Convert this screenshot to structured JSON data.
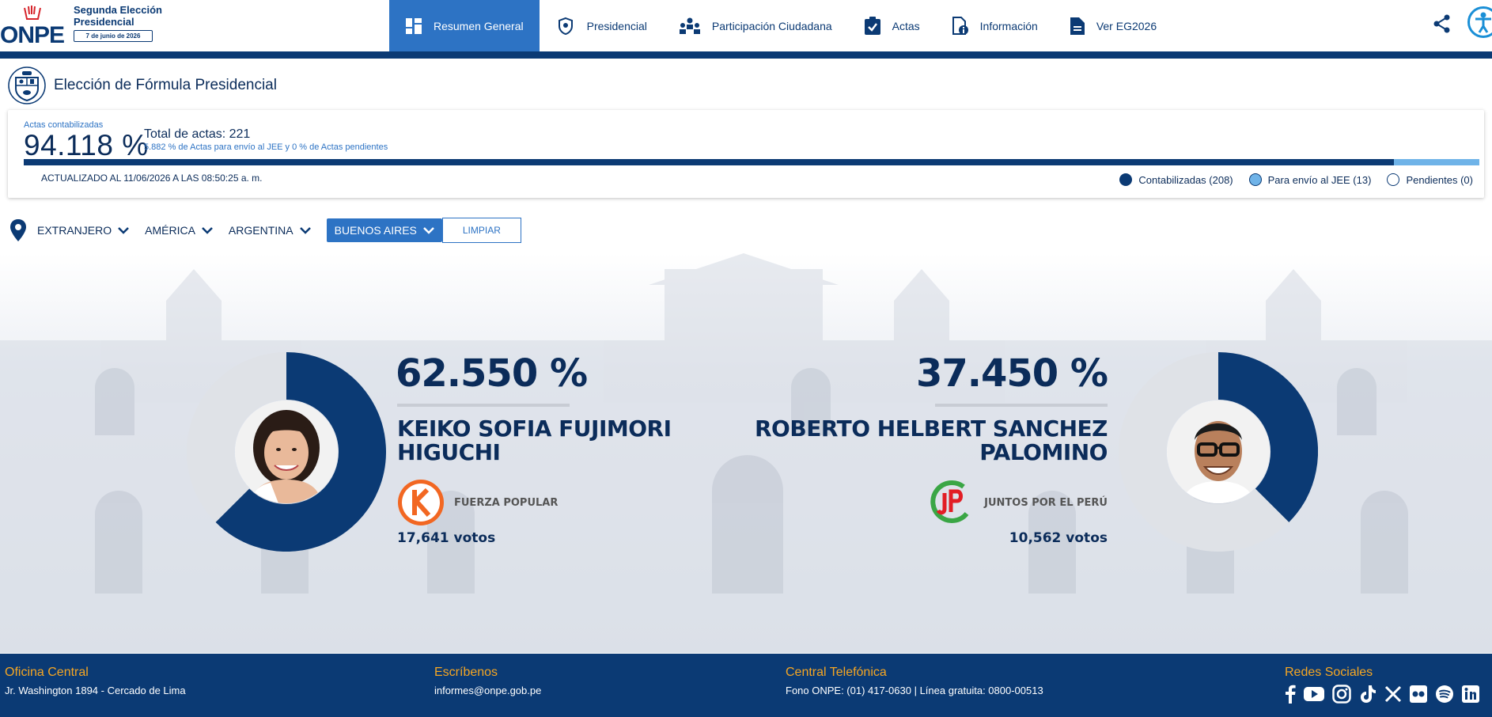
{
  "header": {
    "logo_text": "ONPE",
    "election_title": "Segunda Elección Presidencial",
    "election_date": "7 de junio de 2026",
    "nav": [
      {
        "label": "Resumen General",
        "icon": "dashboard-icon",
        "active": true
      },
      {
        "label": "Presidencial",
        "icon": "shield-icon",
        "active": false
      },
      {
        "label": "Participación Ciudadana",
        "icon": "people-icon",
        "active": false
      },
      {
        "label": "Actas",
        "icon": "clipboard-check-icon",
        "active": false
      },
      {
        "label": "Información",
        "icon": "info-document-icon",
        "active": false
      },
      {
        "label": "Ver EG2026",
        "icon": "document-icon",
        "active": false
      }
    ]
  },
  "page": {
    "title": "Elección de Fórmula Presidencial"
  },
  "progress": {
    "actas_label": "Actas contabilizadas",
    "actas_pct": "94.118 %",
    "total_actas": "Total de actas: 221",
    "note": "5.882 % de Actas para envío al JEE y 0 % de Actas pendientes",
    "updated": "ACTUALIZADO AL 11/06/2026 A LAS 08:50:25 a. m.",
    "contabilizadas_fraction": 0.94118,
    "jee_fraction": 0.05882,
    "legend": [
      {
        "label": "Contabilizadas (208)",
        "color": "#0b3a74"
      },
      {
        "label": "Para envío al JEE (13)",
        "color": "#6fb3e8"
      },
      {
        "label": "Pendientes (0)",
        "color": "#ffffff"
      }
    ]
  },
  "filters": {
    "items": [
      "EXTRANJERO",
      "AMÉRICA",
      "ARGENTINA"
    ],
    "active": "BUENOS AIRES",
    "clear_label": "LIMPIAR"
  },
  "candidates": [
    {
      "pct": "62.550 %",
      "share": 0.6255,
      "name_line1": "KEIKO SOFIA FUJIMORI",
      "name_line2": "HIGUCHI",
      "party": "FUERZA POPULAR",
      "votes": "17,641 votos",
      "party_color": "#f26722"
    },
    {
      "pct": "37.450 %",
      "share": 0.3745,
      "name_line1": "ROBERTO HELBERT SANCHEZ",
      "name_line2": "PALOMINO",
      "party": "JUNTOS POR EL PERÚ",
      "votes": "10,562 votos",
      "party_color": "#3aa645"
    }
  ],
  "footer": {
    "office_title": "Oficina Central",
    "office_text": "Jr. Washington 1894 - Cercado de Lima",
    "write_title": "Escríbenos",
    "write_text": "informes@onpe.gob.pe",
    "phone_title": "Central Telefónica",
    "phone_text": "Fono ONPE: (01) 417-0630 | Línea gratuita: 0800-00513",
    "social_title": "Redes Sociales",
    "social_icons": [
      "facebook-icon",
      "youtube-icon",
      "instagram-icon",
      "tiktok-icon",
      "x-icon",
      "flickr-icon",
      "spotify-icon",
      "linkedin-icon"
    ]
  }
}
